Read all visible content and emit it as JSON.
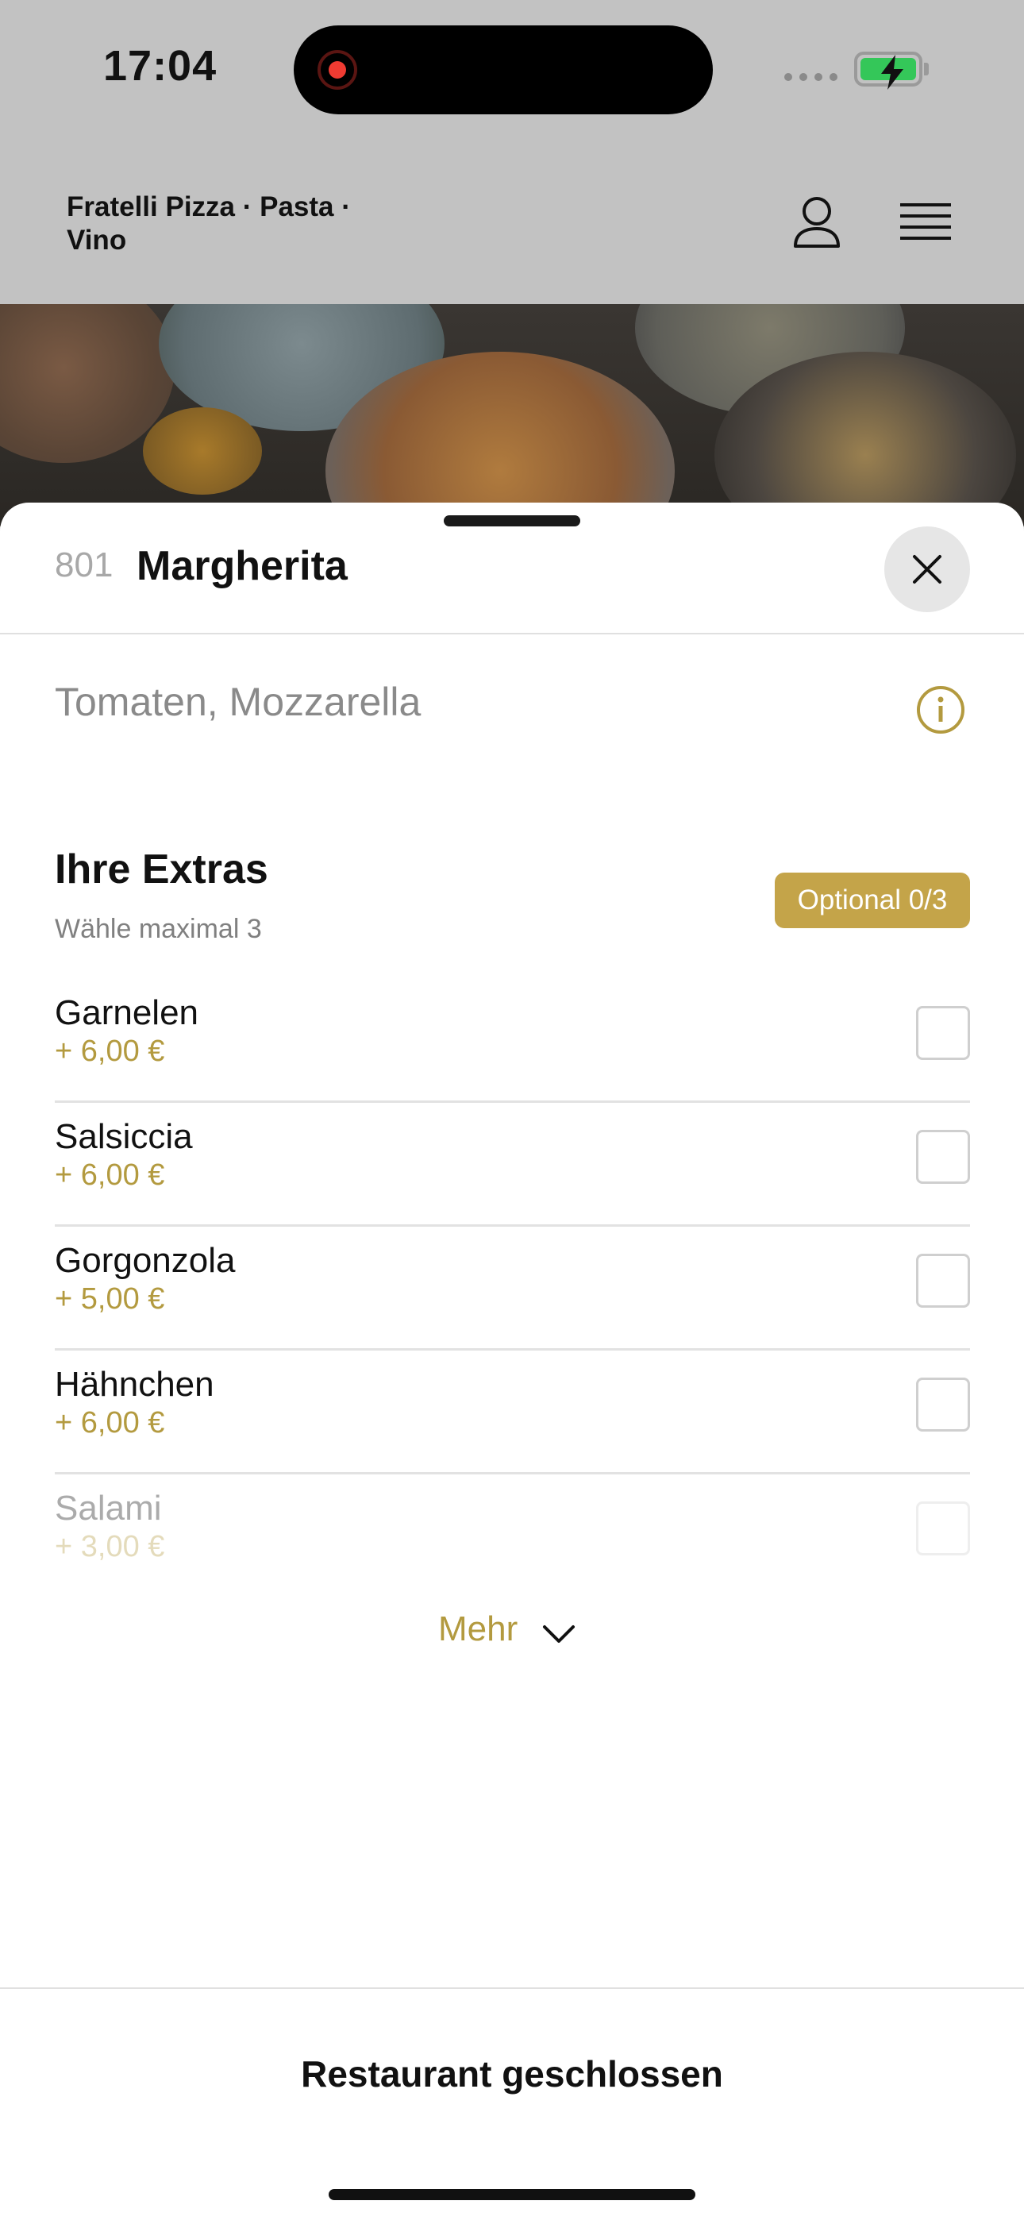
{
  "status_bar": {
    "time": "17:04",
    "recording_icon": "screen-recording-dot",
    "signal_icon": "cellular-signal",
    "battery_icon": "battery-charging"
  },
  "header": {
    "brand": "Fratelli Pizza · Pasta · Vino",
    "account_icon": "user-icon",
    "menu_icon": "hamburger-menu-icon"
  },
  "hero": {
    "image": "food-table-photo"
  },
  "product": {
    "number": "801",
    "name": "Margherita",
    "description": "Tomaten, Mozzarella",
    "close_icon": "close-icon",
    "info_icon": "info-icon"
  },
  "extras": {
    "title": "Ihre Extras",
    "subtitle": "Wähle maximal 3",
    "badge": "Optional 0/3",
    "items": [
      {
        "name": "Garnelen",
        "price": "+ 6,00 €",
        "checked": false
      },
      {
        "name": "Salsiccia",
        "price": "+ 6,00 €",
        "checked": false
      },
      {
        "name": "Gorgonzola",
        "price": "+ 5,00 €",
        "checked": false
      },
      {
        "name": "Hähnchen",
        "price": "+ 6,00 €",
        "checked": false
      },
      {
        "name": "Salami",
        "price": "+ 3,00 €",
        "checked": false
      }
    ],
    "more_label": "Mehr"
  },
  "footer": {
    "status": "Restaurant geschlossen"
  },
  "colors": {
    "accent": "#c4a449",
    "price": "#b39a3f",
    "overlay": "#c2c2c2"
  }
}
